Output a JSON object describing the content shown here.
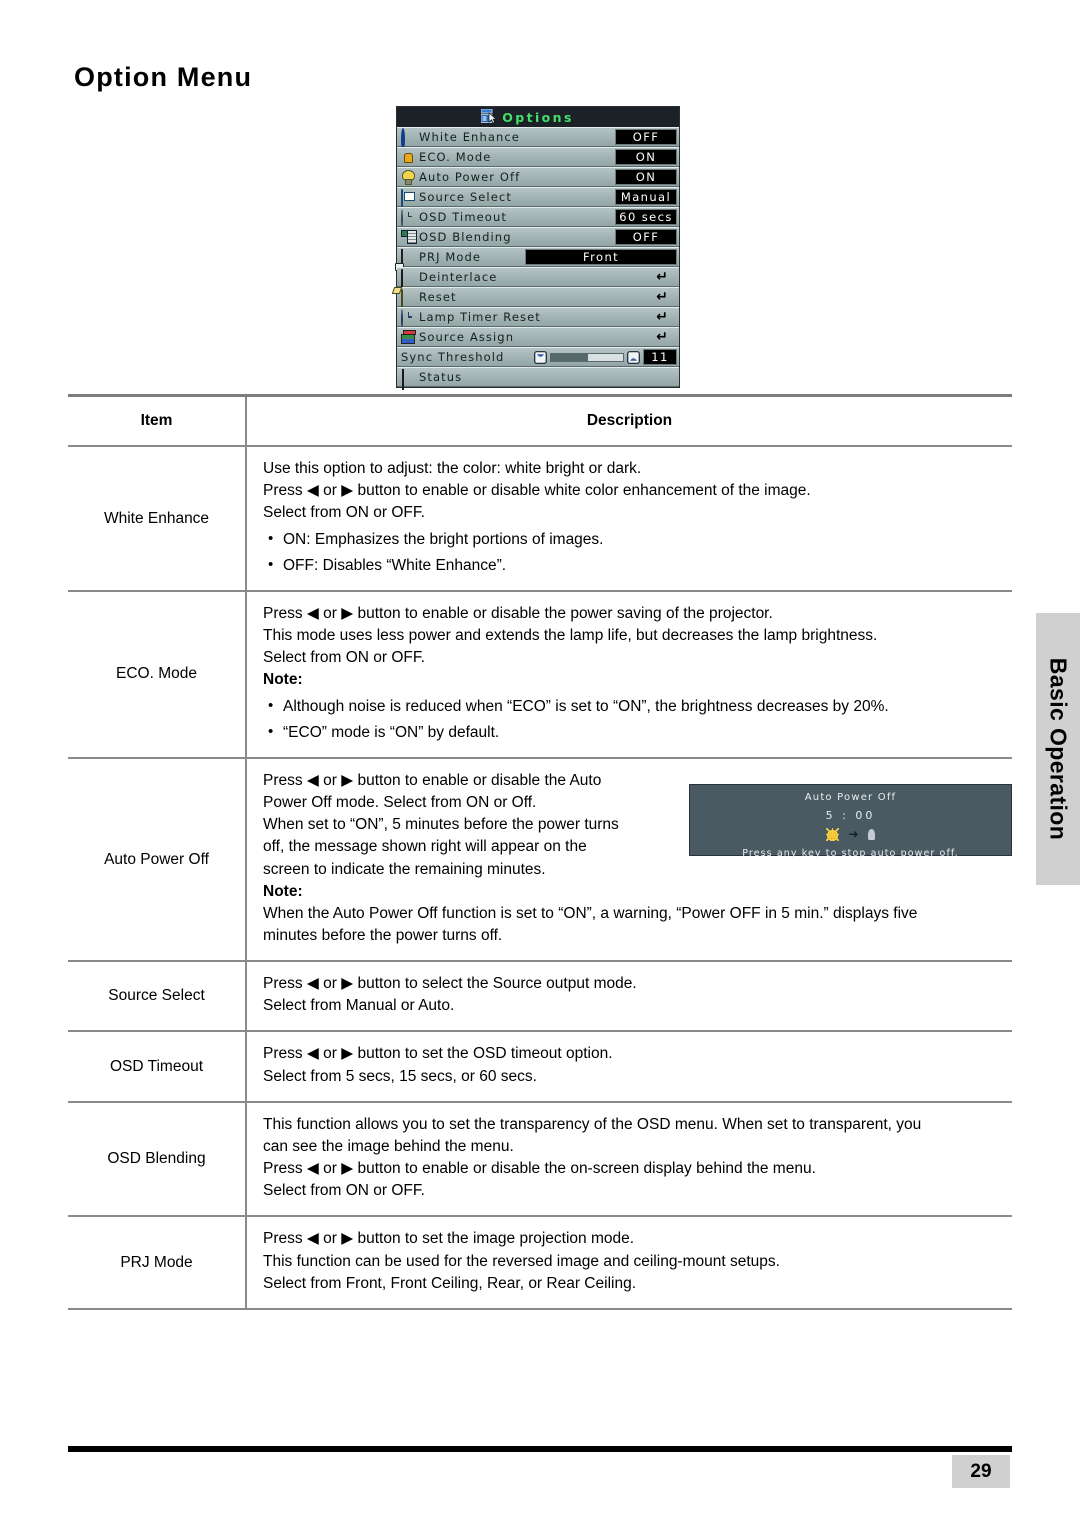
{
  "page": {
    "title": "Option Menu",
    "side_tab_label": "Basic Operation",
    "page_number": "29"
  },
  "osd": {
    "title": "Options",
    "title_icon": "options-window-icon",
    "rows": [
      {
        "icon": "white-enhance-circle-icon",
        "label": "White Enhance",
        "value": "OFF",
        "kind": "value-narrow"
      },
      {
        "icon": "eco-lamp-icon",
        "label": "ECO. Mode",
        "value": "ON",
        "kind": "value-narrow"
      },
      {
        "icon": "bulb-icon",
        "label": "Auto Power Off",
        "value": "ON",
        "kind": "value-narrow"
      },
      {
        "icon": "source-camera-icon",
        "label": "Source Select",
        "value": "Manual",
        "kind": "value-narrow"
      },
      {
        "icon": "clock-icon",
        "label": "OSD Timeout",
        "value": "60 secs",
        "kind": "value-narrow"
      },
      {
        "icon": "osd-blending-list-icon",
        "label": "OSD Blending",
        "value": "OFF",
        "kind": "value-narrow"
      },
      {
        "icon": "prj-mode-icon",
        "label": "PRJ Mode",
        "value": "Front",
        "kind": "value-wide"
      },
      {
        "icon": "deinterlace-icon",
        "label": "Deinterlace",
        "value": "↵",
        "kind": "enter"
      },
      {
        "icon": "reset-folder-icon",
        "label": "Reset",
        "value": "↵",
        "kind": "enter"
      },
      {
        "icon": "lamp-timer-clock-icon",
        "label": "Lamp Timer Reset",
        "value": "↵",
        "kind": "enter"
      },
      {
        "icon": "source-assign-icon",
        "label": "Source Assign",
        "value": "↵",
        "kind": "enter"
      },
      {
        "icon": "none",
        "label": "Sync Threshold",
        "value": "11",
        "kind": "slider"
      },
      {
        "icon": "status-doc-icon",
        "label": "Status",
        "value": "",
        "kind": "plain"
      }
    ]
  },
  "table": {
    "headers": {
      "item": "Item",
      "description": "Description"
    },
    "rows": [
      {
        "item": "White Enhance",
        "lines": [
          "Use this option to adjust: the color: white bright or dark.",
          "Press ◀ or ▶ button to enable or disable white color enhancement of the image.",
          "Select from ON or OFF."
        ],
        "bullets": [
          "ON: Emphasizes the bright portions of images.",
          "OFF: Disables “White Enhance”."
        ]
      },
      {
        "item": "ECO. Mode",
        "lines": [
          "Press ◀ or ▶ button to enable or disable the power saving of the projector.",
          "This mode uses less power and extends the lamp life, but decreases the lamp brightness.",
          "Select from ON or OFF."
        ],
        "note_label": "Note:",
        "bullets": [
          "Although noise is reduced when “ECO” is set to “ON”, the brightness decreases by 20%.",
          "“ECO” mode is “ON” by default."
        ]
      },
      {
        "item": "Auto Power Off",
        "lines": [
          "Press ◀ or ▶ button to enable or disable the Auto",
          "Power Off mode. Select from ON or Off.",
          "When set to “ON”, 5 minutes before the power turns",
          "off, the message shown right will appear on the",
          "screen to indicate the remaining minutes."
        ],
        "note_label": "Note:",
        "note_lines": [
          "When the Auto Power Off function is set to “ON”, a warning, “Power OFF in 5 min.” displays five",
          "minutes before the power turns off."
        ],
        "screenshot": {
          "title": "Auto Power Off",
          "time": "5 : 00",
          "lamp_icon": "lamp-on-icon",
          "arrow_icon": "arrow-right-icon",
          "off_icon": "lamp-off-icon",
          "message": "Press any key to stop auto power off."
        }
      },
      {
        "item": "Source Select",
        "lines": [
          "Press ◀ or ▶ button to select the Source output mode.",
          "Select from Manual or Auto."
        ]
      },
      {
        "item": "OSD Timeout",
        "lines": [
          "Press ◀ or ▶ button to set the OSD timeout option.",
          "Select from 5 secs, 15 secs, or 60 secs."
        ]
      },
      {
        "item": "OSD Blending",
        "lines": [
          "This function allows you to set the transparency of the OSD menu. When set to transparent, you",
          "can see the image behind the menu.",
          "Press ◀ or ▶ button to enable or disable the on-screen display behind the menu.",
          "Select from ON or OFF."
        ]
      },
      {
        "item": "PRJ Mode",
        "lines": [
          "Press ◀ or ▶ button to set the image projection mode.",
          "This function can be used for the reversed image and ceiling-mount setups.",
          "Select from Front, Front Ceiling, Rear, or Rear Ceiling."
        ]
      }
    ]
  }
}
